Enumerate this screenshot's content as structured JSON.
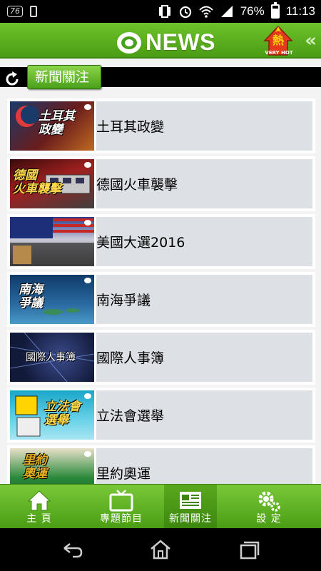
{
  "status_bar": {
    "badge": "76",
    "battery": "76%",
    "time": "11:13"
  },
  "header": {
    "logo_text": "NEWS",
    "hot_char": "熱",
    "hot_label": "VERY HOT",
    "collapse_icon": "double-chevron-left-icon"
  },
  "section": {
    "title": "新聞關注",
    "refresh_icon": "refresh-icon"
  },
  "topics": [
    {
      "label": "土耳其政變",
      "thumb_text": "土耳其\n政變"
    },
    {
      "label": "德國火車襲擊",
      "thumb_text": "德國\n火車襲擊"
    },
    {
      "label": "美國大選2016",
      "thumb_text": ""
    },
    {
      "label": "南海爭議",
      "thumb_text": "南海\n爭議"
    },
    {
      "label": "國際人事簿",
      "thumb_text": "國際人事簿"
    },
    {
      "label": "立法會選舉",
      "thumb_text": "立法會\n選舉"
    },
    {
      "label": "里約奧運",
      "thumb_text": "里約\n奧運"
    }
  ],
  "bottom_nav": [
    {
      "label": "主 頁",
      "icon": "home-icon",
      "active": false
    },
    {
      "label": "專題節目",
      "icon": "tv-icon",
      "active": false
    },
    {
      "label": "新聞關注",
      "icon": "newspaper-icon",
      "active": true
    },
    {
      "label": "設 定",
      "icon": "gear-icon",
      "active": false
    }
  ],
  "colors": {
    "brand_green": "#4a9d14",
    "label_bg": "#dde0e5"
  }
}
